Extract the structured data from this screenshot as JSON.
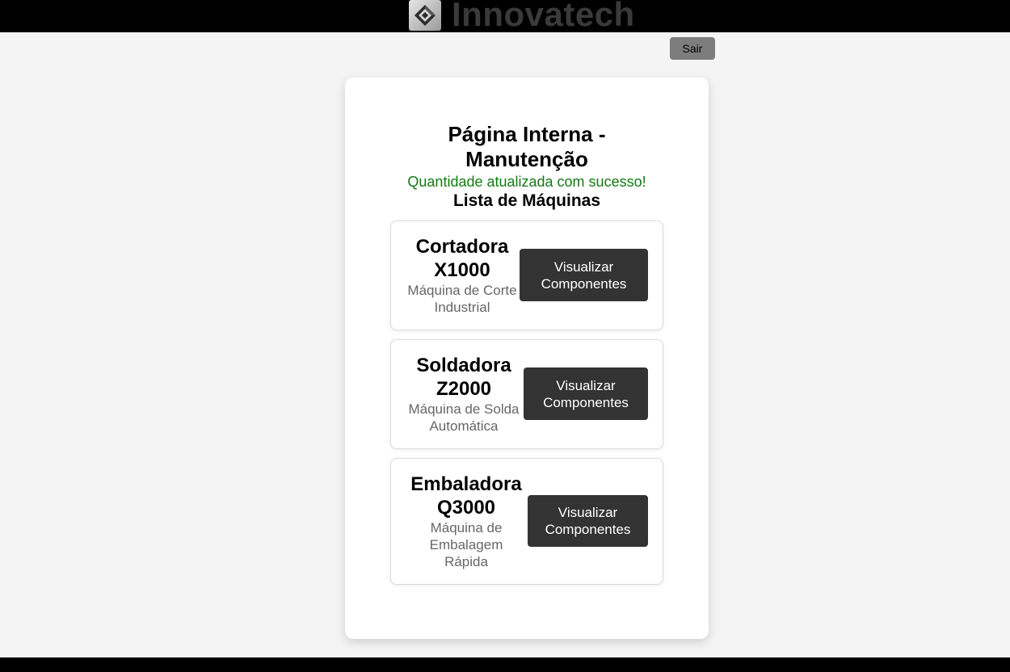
{
  "header": {
    "brand_name": "Innovatech",
    "logo_icon": "diamond-logo-icon"
  },
  "actions": {
    "logout_label": "Sair"
  },
  "page": {
    "title": "Página Interna - Manutenção",
    "success_message": "Quantidade atualizada com sucesso!",
    "list_title": "Lista de Máquinas"
  },
  "machines": [
    {
      "name": "Cortadora X1000",
      "description": "Máquina de Corte Industrial",
      "button_label": "Visualizar Componentes"
    },
    {
      "name": "Soldadora Z2000",
      "description": "Máquina de Solda Automática",
      "button_label": "Visualizar Componentes"
    },
    {
      "name": "Embaladora Q3000",
      "description": "Máquina de Embalagem Rápida",
      "button_label": "Visualizar Componentes"
    }
  ],
  "colors": {
    "success": "#137a13",
    "button_dark": "#333333",
    "logout_button": "#7d7d7d"
  }
}
